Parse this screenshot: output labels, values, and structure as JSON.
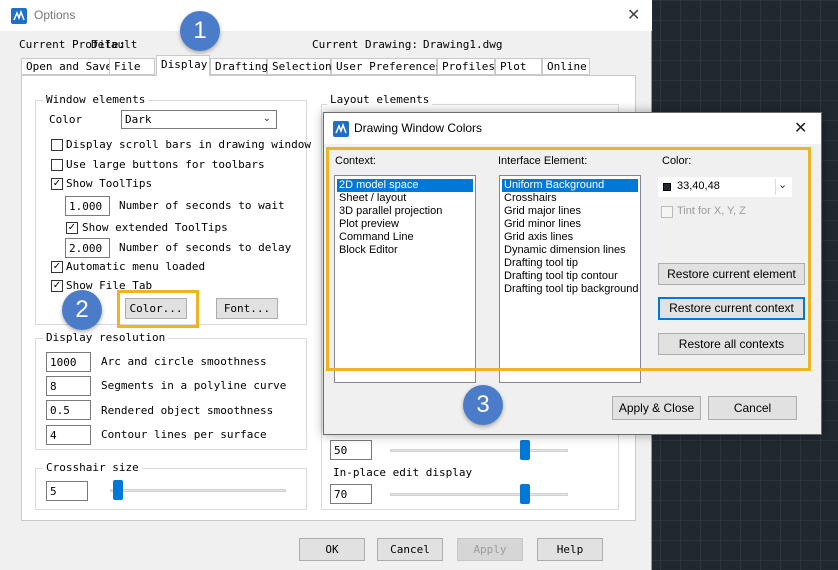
{
  "options_window": {
    "title": "Options",
    "current_profile_label": "Current Profile:",
    "current_profile_value": "Default",
    "current_drawing_label": "Current Drawing:",
    "current_drawing_value": "Drawing1.dwg",
    "tabs": [
      "Open and Save",
      "File",
      "Display",
      "Drafting",
      "Selection",
      "User Preferences",
      "Profiles",
      "Plot",
      "Online"
    ],
    "active_tab": "Display",
    "window_elements": {
      "title": "Window elements",
      "color_label": "Color",
      "color_value": "Dark",
      "checkboxes": [
        {
          "label": "Display scroll bars in drawing window",
          "checked": false
        },
        {
          "label": "Use large buttons for toolbars",
          "checked": false
        },
        {
          "label": "Show ToolTips",
          "checked": true
        },
        {
          "label": "Show extended ToolTips",
          "checked": true
        },
        {
          "label": "Automatic menu loaded",
          "checked": true
        },
        {
          "label": "Show File Tab",
          "checked": true
        }
      ],
      "tooltip_wait_value": "1.000",
      "tooltip_wait_label": "Number of seconds to wait",
      "tooltip_delay_value": "2.000",
      "tooltip_delay_label": "Number of seconds to delay",
      "color_button": "Color...",
      "font_button": "Font..."
    },
    "display_resolution": {
      "title": "Display resolution",
      "items": [
        {
          "value": "1000",
          "label": "Arc and circle smoothness"
        },
        {
          "value": "8",
          "label": "Segments in a polyline curve"
        },
        {
          "value": "0.5",
          "label": "Rendered object smoothness"
        },
        {
          "value": "4",
          "label": "Contour lines per surface"
        }
      ]
    },
    "crosshair": {
      "title": "Crosshair size",
      "value": "5",
      "slider_fraction": 0.05
    },
    "layout_elements": {
      "title": "Layout elements"
    },
    "fade_value": "50",
    "fade_slider_fraction": 0.5,
    "inplace": {
      "title": "In-place edit display",
      "value": "70",
      "slider_fraction": 0.7
    },
    "footer_buttons": {
      "ok": "OK",
      "cancel": "Cancel",
      "apply": "Apply",
      "help": "Help"
    }
  },
  "dwc_dialog": {
    "title": "Drawing Window Colors",
    "context_label": "Context:",
    "context_items": [
      "2D model space",
      "Sheet / layout",
      "3D parallel projection",
      "Plot preview",
      "Command Line",
      "Block Editor"
    ],
    "context_selected": 0,
    "interface_label": "Interface Element:",
    "interface_items": [
      "Uniform Background",
      "Crosshairs",
      "Grid major lines",
      "Grid minor lines",
      "Grid axis lines",
      "Dynamic dimension lines",
      "Drafting tool tip",
      "Drafting tool tip contour",
      "Drafting tool tip background"
    ],
    "interface_selected": 0,
    "color_label": "Color:",
    "color_value": "33,40,48",
    "color_swatch": "#212830",
    "tint_label": "Tint for X, Y, Z",
    "restore_element": "Restore current element",
    "restore_context": "Restore current context",
    "restore_all": "Restore all contexts",
    "apply_close": "Apply & Close",
    "cancel": "Cancel"
  },
  "annotations": [
    "1",
    "2",
    "3"
  ],
  "colors": {
    "highlight": "#f0b323",
    "badge": "#4a7cc9",
    "selection": "#0078d7",
    "canvas": "#212830"
  }
}
